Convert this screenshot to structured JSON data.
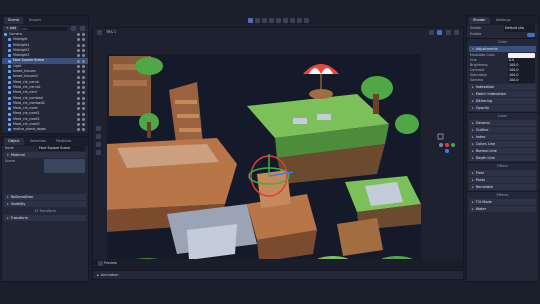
{
  "scene_dock": {
    "tabs": [
      "Scene",
      "Import"
    ],
    "add_label": "+ Add",
    "filter_placeholder": "Filter",
    "nodes": [
      {
        "label": "Camera",
        "depth": 0
      },
      {
        "label": "Midnight",
        "depth": 1
      },
      {
        "label": "Midnight1",
        "depth": 1
      },
      {
        "label": "Midnight2",
        "depth": 1
      },
      {
        "label": "Midnight3",
        "depth": 1
      },
      {
        "label": "Face Square Scene",
        "depth": 1,
        "selected": true
      },
      {
        "label": "Light",
        "depth": 1
      },
      {
        "label": "bread_houses",
        "depth": 1
      },
      {
        "label": "bread_houses2",
        "depth": 1
      },
      {
        "label": "Meat_cle_nerna",
        "depth": 1
      },
      {
        "label": "Meat_cle_nerna1",
        "depth": 1
      },
      {
        "label": "Meat_cle_nerd",
        "depth": 1
      },
      {
        "label": "Meat_cle_nombed",
        "depth": 1
      },
      {
        "label": "Meat_cle_nombed2",
        "depth": 1
      },
      {
        "label": "Meat_cle_noed",
        "depth": 1
      },
      {
        "label": "Meat_cle_noed1",
        "depth": 1
      },
      {
        "label": "Meat_cle_noed2",
        "depth": 1
      },
      {
        "label": "Meat_cle_noed3",
        "depth": 1
      },
      {
        "label": "mattra_stand_doost",
        "depth": 1
      }
    ]
  },
  "inspector_dock": {
    "tabs": [
      "Object",
      "Selection",
      "Particles"
    ],
    "node_label": "Node",
    "node_value": "Face Square Scene",
    "sections": [
      {
        "label": "Material",
        "kind": "header"
      },
      {
        "label": "Scene",
        "kind": "field",
        "value": ""
      },
      {
        "label": "RoSemaStan",
        "kind": "header"
      },
      {
        "label": "Visibility",
        "kind": "header"
      },
      {
        "label": "15 Transform",
        "kind": "info"
      },
      {
        "label": "Transform",
        "kind": "header"
      }
    ]
  },
  "viewport": {
    "view_label": "TRS 1",
    "toolbar_icons": [
      "select-icon",
      "move-icon",
      "rotate-icon",
      "scale-icon",
      "list-icon",
      "lock-icon",
      "snap-icon",
      "paint-icon",
      "draw-icon"
    ],
    "bottom_label": "Preview",
    "side_tools": [
      "camera-icon",
      "grid-icon",
      "light-icon",
      "hand-icon"
    ]
  },
  "bottom_bar": {
    "label": "Animation"
  },
  "shader_dock": {
    "tabs": [
      "Shader",
      "Settings"
    ],
    "shader_label": "Shader",
    "shader_value": "Default sha",
    "enable_label": "Enable",
    "color_group": "Color",
    "adjustments_label": "Adjustments",
    "fields": [
      {
        "label": "Modulate Color",
        "value": ""
      },
      {
        "label": "Hue",
        "value": "0.0"
      },
      {
        "label": "Brightness",
        "value": "100.0"
      },
      {
        "label": "Contrast",
        "value": "100.0"
      },
      {
        "label": "Saturation",
        "value": "100.0"
      },
      {
        "label": "Gamma",
        "value": "100.0"
      }
    ],
    "collapsed_a": [
      "Indexation",
      "Match Indexation",
      "Dithering",
      "Opacity"
    ],
    "lines_group": "Lines",
    "collapsed_b": [
      "General",
      "Outline",
      "Index",
      "Colors Line",
      "Normal Line",
      "Depth Line"
    ],
    "filters_group": "Filters",
    "collapsed_c": [
      "Pixel",
      "Posts",
      "Remoldze"
    ],
    "effects_group": "Effects",
    "collapsed_d": [
      "Tilt Mode",
      "Water"
    ],
    "colors": {
      "accent": "#4a6fbf",
      "modulate": "#f2f2f2"
    }
  }
}
